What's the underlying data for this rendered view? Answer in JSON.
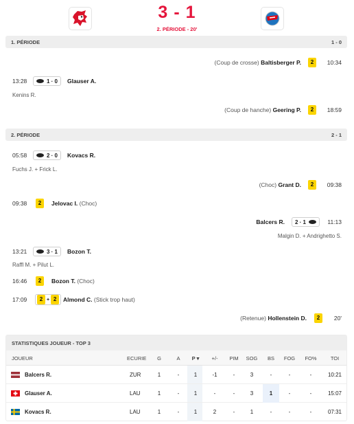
{
  "header": {
    "home_logo": "lausanne-hc-lion-logo",
    "away_logo": "zsc-lions-logo",
    "score_home": "3",
    "score_sep": "-",
    "score_away": "1",
    "status": "2. PÉRIODE - 20'"
  },
  "periods": [
    {
      "title": "1. PÉRIODE",
      "score": "1 - 0",
      "events": [
        {
          "side": "right",
          "type": "penalty",
          "note": "(Coup de crosse)",
          "player": "Baltisberger P.",
          "minutes": "2",
          "time": "10:34"
        },
        {
          "side": "left",
          "type": "goal",
          "time": "13:28",
          "score": "1 · 0",
          "player": "Glauser A.",
          "assist": "Kenins R."
        },
        {
          "side": "right",
          "type": "penalty",
          "note": "(Coup de hanche)",
          "player": "Geering P.",
          "minutes": "2",
          "time": "18:59"
        }
      ]
    },
    {
      "title": "2. PÉRIODE",
      "score": "2 - 1",
      "events": [
        {
          "side": "left",
          "type": "goal",
          "time": "05:58",
          "score": "2 · 0",
          "player": "Kovacs R.",
          "assist": "Fuchs J. + Frick L."
        },
        {
          "side": "right",
          "type": "penalty",
          "note": "(Choc)",
          "player": "Grant D.",
          "minutes": "2",
          "time": "09:38"
        },
        {
          "side": "left",
          "type": "penalty",
          "time": "09:38",
          "minutes": "2",
          "player": "Jelovac I.",
          "note": "(Choc)"
        },
        {
          "side": "right",
          "type": "goal",
          "player": "Balcers R.",
          "score": "2 · 1",
          "time": "11:13",
          "assist": "Malgin D. + Andrighetto S."
        },
        {
          "side": "left",
          "type": "goal",
          "time": "13:21",
          "score": "3 · 1",
          "player": "Bozon T.",
          "assist": "Raffl M. + Pilut L."
        },
        {
          "side": "left",
          "type": "penalty",
          "time": "16:46",
          "minutes": "2",
          "player": "Bozon T.",
          "note": "(Choc)"
        },
        {
          "side": "left",
          "type": "double-penalty",
          "time": "17:09",
          "minutes_a": "2",
          "plus": "+",
          "minutes_b": "2",
          "player": "Almond C.",
          "note": "(Stick trop haut)"
        },
        {
          "side": "right",
          "type": "penalty",
          "note": "(Retenue)",
          "player": "Hollenstein D.",
          "minutes": "2",
          "time": "20'"
        }
      ]
    }
  ],
  "stats": {
    "title": "STATISTIQUES JOUEUR - TOP 3",
    "columns": [
      "JOUEUR",
      "ECURIE",
      "G",
      "A",
      "P ▾",
      "+/-",
      "PIM",
      "SOG",
      "BS",
      "FOG",
      "FO%",
      "TOI"
    ],
    "rows": [
      {
        "flag": "latvia-flag",
        "player": "Balcers R.",
        "team": "ZUR",
        "g": "1",
        "a": "-",
        "p": "1",
        "pm": "-1",
        "pim": "-",
        "sog": "3",
        "bs": "-",
        "fog": "-",
        "fo": "-",
        "toi": "10:21"
      },
      {
        "flag": "switzerland-flag",
        "player": "Glauser A.",
        "team": "LAU",
        "g": "1",
        "a": "-",
        "p": "1",
        "pm": "-",
        "pim": "-",
        "sog": "3",
        "bs": "1",
        "fog": "-",
        "fo": "-",
        "toi": "15:07"
      },
      {
        "flag": "sweden-flag",
        "player": "Kovacs R.",
        "team": "LAU",
        "g": "1",
        "a": "-",
        "p": "1",
        "pm": "2",
        "pim": "-",
        "sog": "1",
        "bs": "-",
        "fog": "-",
        "fo": "-",
        "toi": "07:31"
      }
    ]
  },
  "colors": {
    "accent": "#e5153c",
    "penalty": "#fbd400",
    "header_bg": "#eeeeee"
  }
}
